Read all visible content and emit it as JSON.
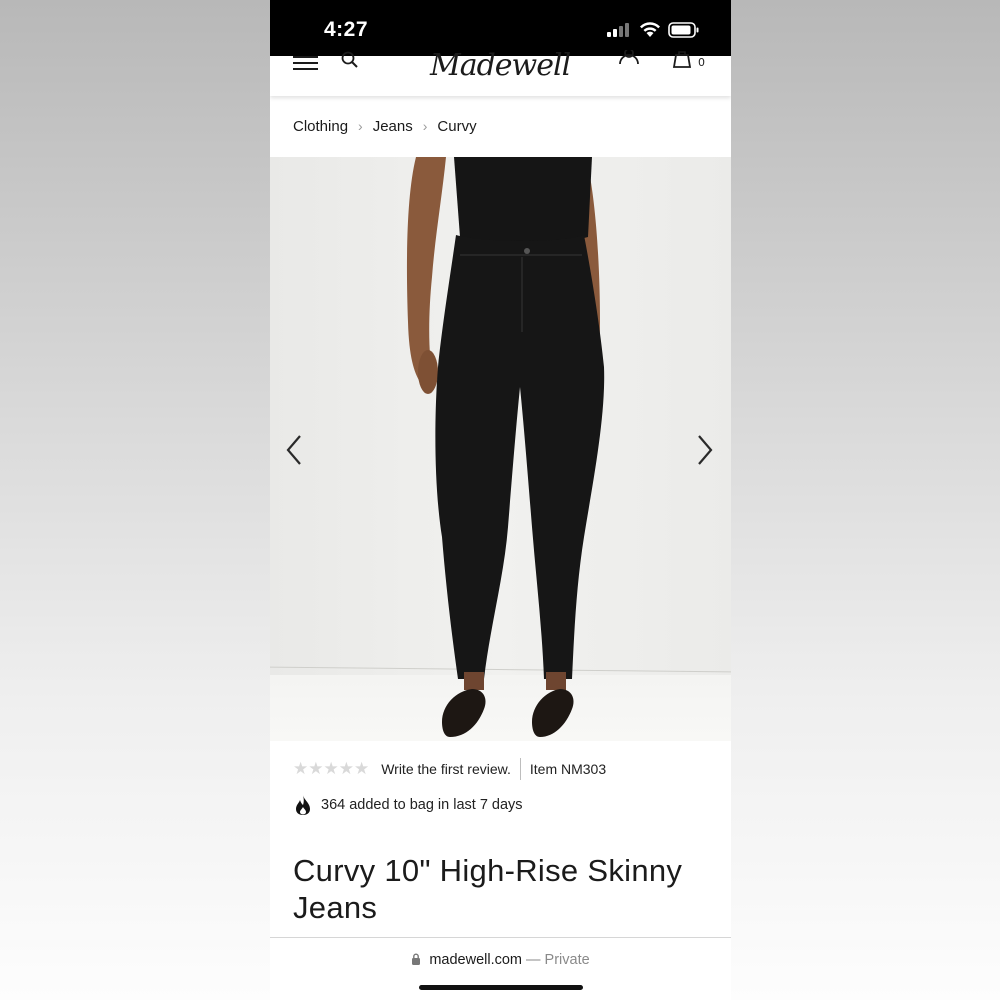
{
  "status_bar": {
    "time": "4:27"
  },
  "header": {
    "logo": "Madewell",
    "bag_count": "0"
  },
  "breadcrumb": [
    "Clothing",
    "Jeans",
    "Curvy"
  ],
  "reviews": {
    "stars": "★★★★★",
    "write_review": "Write the first review.",
    "item_number": "Item NM303"
  },
  "popularity": {
    "text": "364 added to bag in last 7 days"
  },
  "product": {
    "title": "Curvy 10\" High-Rise Skinny Jeans"
  },
  "browser": {
    "domain": "madewell.com",
    "privacy": "— Private"
  },
  "colors": {
    "accent": "#1b1b1b",
    "star_empty": "#d9d9d9",
    "status_bar": "#000000"
  }
}
